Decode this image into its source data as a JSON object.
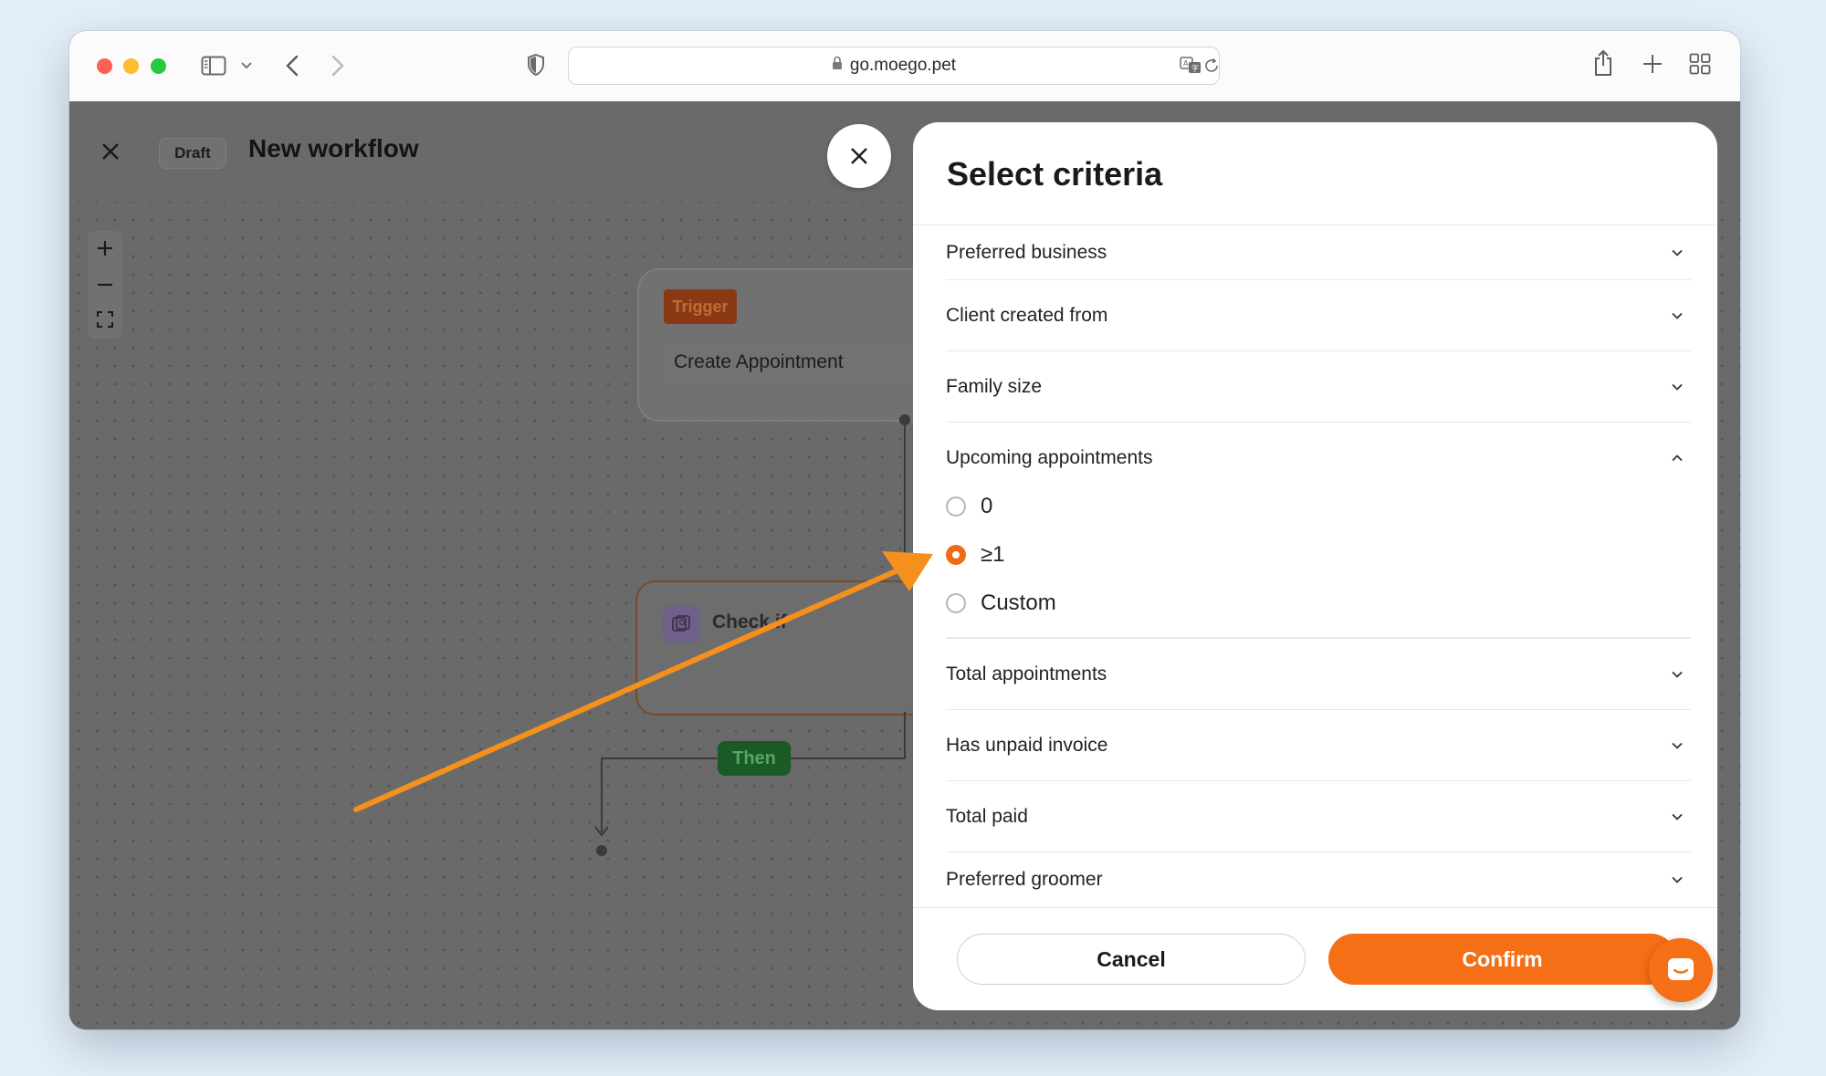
{
  "browser": {
    "url": "go.moego.pet"
  },
  "header": {
    "status_badge": "Draft",
    "title": "New workflow"
  },
  "canvas": {
    "trigger_badge": "Trigger",
    "trigger_value": "Create Appointment",
    "check_label": "Check if",
    "then_label": "Then"
  },
  "modal": {
    "title": "Select criteria",
    "criteria": [
      {
        "label": "Preferred business",
        "expanded": false
      },
      {
        "label": "Client created from",
        "expanded": false
      },
      {
        "label": "Family size",
        "expanded": false
      },
      {
        "label": "Upcoming appointments",
        "expanded": true
      },
      {
        "label": "Total appointments",
        "expanded": false
      },
      {
        "label": "Has unpaid invoice",
        "expanded": false
      },
      {
        "label": "Total paid",
        "expanded": false
      },
      {
        "label": "Preferred groomer",
        "expanded": false
      }
    ],
    "upcoming_options": [
      {
        "label": "0",
        "selected": false
      },
      {
        "label": "≥1",
        "selected": true
      },
      {
        "label": "Custom",
        "selected": false
      }
    ],
    "cancel_label": "Cancel",
    "confirm_label": "Confirm"
  },
  "colors": {
    "accent": "#f56f16",
    "annotation_arrow": "#f5901c"
  }
}
